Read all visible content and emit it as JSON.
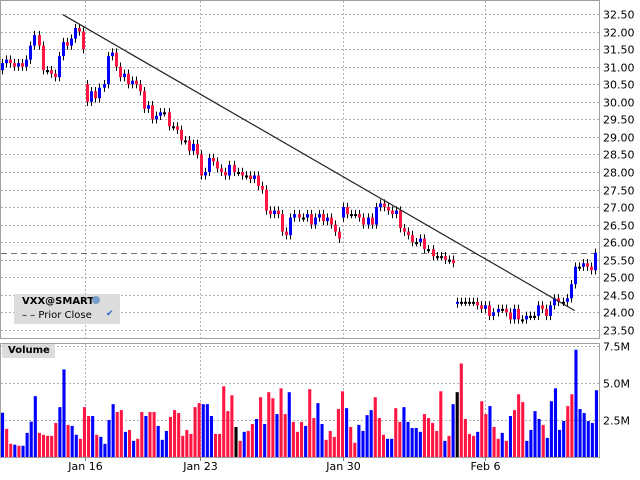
{
  "chart_data": {
    "type": "candlestick",
    "symbol": "VXX@SMART",
    "legend_prior_close": "Prior Close",
    "volume_title": "Volume",
    "prior_close": 25.69,
    "price_ylim": [
      23.25,
      32.85
    ],
    "price_ticks": [
      "32.50",
      "32.00",
      "31.50",
      "31.00",
      "30.50",
      "30.00",
      "29.50",
      "29.00",
      "28.50",
      "28.00",
      "27.50",
      "27.00",
      "26.50",
      "26.00",
      "25.50",
      "25.00",
      "24.50",
      "24.00",
      "23.50"
    ],
    "volume_ticks": [
      "7.5M",
      "5.0M",
      "2.5M"
    ],
    "volume_tick_values": [
      7.5,
      5.0,
      2.5
    ],
    "x_labels": [
      "Jan 16",
      "Jan 23",
      "Jan 30",
      "Feb 6"
    ],
    "x_label_bar_index": [
      20.5,
      48.8,
      84,
      118.8
    ],
    "trendline": {
      "from": [
        15,
        32.48
      ],
      "to": [
        141,
        24.05
      ]
    },
    "colors": {
      "up": "#0000ff",
      "down": "#ff1744",
      "flat": "#000000"
    },
    "close": [
      31.1,
      31.2,
      31.1,
      31.0,
      31.1,
      31.0,
      31.2,
      31.6,
      31.9,
      31.6,
      30.9,
      30.9,
      30.8,
      30.7,
      31.3,
      31.7,
      31.6,
      31.8,
      32.1,
      32.0,
      31.5,
      30.0,
      30.3,
      30.1,
      30.4,
      30.5,
      31.3,
      31.4,
      31.0,
      30.7,
      30.8,
      30.5,
      30.6,
      30.5,
      30.3,
      29.8,
      29.9,
      29.5,
      29.6,
      29.7,
      29.7,
      29.3,
      29.3,
      29.2,
      28.9,
      28.9,
      28.6,
      28.8,
      28.5,
      27.9,
      28.0,
      28.4,
      28.3,
      28.1,
      28.0,
      27.9,
      28.2,
      28.0,
      28.0,
      27.9,
      27.9,
      27.8,
      27.9,
      27.6,
      27.5,
      26.9,
      26.8,
      26.9,
      26.8,
      26.3,
      26.2,
      26.7,
      26.8,
      26.7,
      26.7,
      26.8,
      26.5,
      26.7,
      26.8,
      26.6,
      26.7,
      26.5,
      26.3,
      26.1,
      27.0,
      26.8,
      26.8,
      26.8,
      26.7,
      26.5,
      26.7,
      26.5,
      27.0,
      27.1,
      27.0,
      26.9,
      26.8,
      26.9,
      26.4,
      26.3,
      26.2,
      26.0,
      26.0,
      26.1,
      25.8,
      25.8,
      25.6,
      25.6,
      25.6,
      25.5,
      25.5,
      25.4,
      24.3,
      24.3,
      24.3,
      24.3,
      24.3,
      24.2,
      24.1,
      24.2,
      23.9,
      24.0,
      24.1,
      24.1,
      24.0,
      23.8,
      24.1,
      23.8,
      23.8,
      23.9,
      23.9,
      23.9,
      24.2,
      24.1,
      23.9,
      24.2,
      24.4,
      24.3,
      24.3,
      24.4,
      24.8,
      25.3,
      25.3,
      25.4,
      25.3,
      25.2,
      25.7
    ],
    "gap_opens": {
      "0": 30.9,
      "21": 30.5,
      "84": 26.7,
      "112": 24.25
    },
    "volume_millions": [
      2.99,
      1.9,
      0.89,
      0.83,
      0.76,
      0.76,
      1.63,
      2.39,
      4.11,
      1.63,
      1.5,
      1.43,
      1.43,
      2.3,
      3.37,
      5.92,
      2.17,
      2.1,
      1.5,
      1.23,
      3.37,
      2.77,
      2.77,
      1.5,
      1.36,
      0.89,
      2.5,
      3.57,
      3.04,
      3.17,
      1.7,
      1.83,
      1.09,
      1.23,
      3.04,
      2.77,
      3.04,
      3.04,
      2.1,
      1.16,
      1.76,
      2.7,
      3.17,
      2.97,
      1.43,
      1.83,
      1.56,
      3.37,
      3.64,
      3.57,
      3.57,
      2.77,
      1.56,
      1.56,
      4.78,
      3.1,
      4.17,
      2.03,
      1.09,
      1.7,
      1.76,
      2.23,
      2.57,
      4.04,
      2.23,
      4.38,
      3.97,
      2.9,
      4.64,
      2.9,
      4.38,
      2.37,
      1.7,
      2.37,
      2.1,
      4.58,
      2.63,
      3.64,
      2.23,
      1.16,
      1.76,
      1.36,
      3.24,
      4.44,
      3.3,
      2.03,
      0.96,
      2.17,
      1.76,
      2.83,
      3.17,
      4.04,
      2.63,
      1.5,
      1.23,
      1.23,
      3.3,
      2.37,
      3.37,
      2.37,
      1.96,
      1.96,
      1.7,
      2.9,
      2.63,
      2.3,
      1.76,
      4.44,
      1.09,
      1.43,
      3.57,
      4.38,
      6.32,
      2.57,
      1.56,
      1.43,
      1.7,
      3.77,
      2.9,
      3.44,
      2.03,
      1.23,
      1.63,
      1.09,
      2.77,
      3.17,
      4.24,
      3.71,
      1.09,
      1.83,
      3.1,
      2.57,
      2.17,
      1.29,
      3.77,
      4.64,
      1.83,
      2.43,
      3.44,
      4.24,
      7.25,
      3.24,
      2.97,
      2.43,
      2.3,
      4.51
    ],
    "volume_dir": "brrbrbbbbrrrrrbbrbbrrrbrbbbbrrbrbrrbrrbbbrrrrrrrrbbbrrrrrkrbrrbrbrrbrrbrrrbrrbbrrrrrbrrbbbbrrrbbrrbbbbbrrrrrbrbkrrrrbrrbrrbrbrrrbbbbrbbbbbrrb"
  }
}
